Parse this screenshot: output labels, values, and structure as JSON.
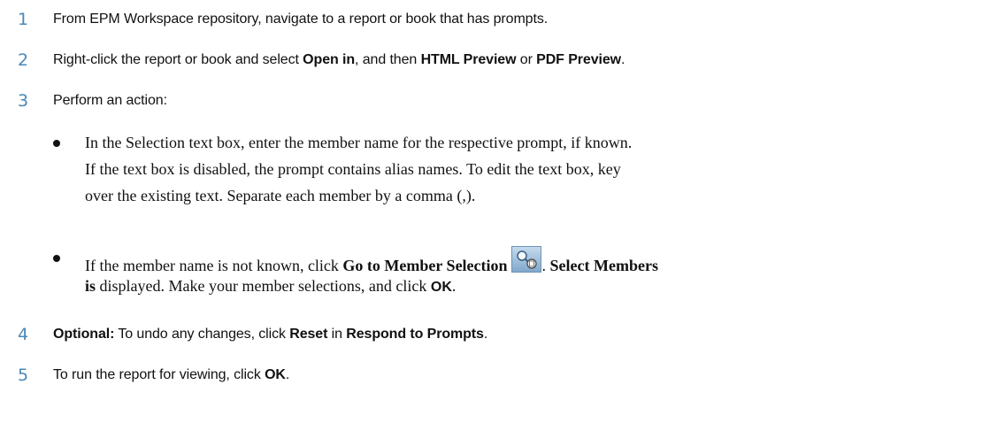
{
  "steps": [
    {
      "number": "1",
      "text": "From EPM Workspace repository, navigate to a report or book that has prompts."
    },
    {
      "number": "2",
      "text_a": "Right-click the report or book and select ",
      "bold_a": "Open in",
      "text_b": ", and then ",
      "bold_b": "HTML Preview",
      "text_c": " or ",
      "bold_c": "PDF Preview",
      "text_d": "."
    },
    {
      "number": "3",
      "text": "Perform an action:"
    },
    {
      "number": "4",
      "bold_a": "Optional:",
      "text_a": " To undo any changes, click ",
      "bold_b": "Reset",
      "text_b": " in ",
      "bold_c": "Respond to Prompts",
      "text_c": "."
    },
    {
      "number": "5",
      "text_a": "To run the report for viewing, click ",
      "bold_a": "OK",
      "text_b": "."
    }
  ],
  "bullets": [
    {
      "line1": "In the Selection text box, enter the member name for the respective prompt, if known.",
      "line2": "If the text box is disabled, the prompt contains alias names. To edit the text box, key",
      "line3": "over the existing text. Separate each member by a comma (,)."
    },
    {
      "line1_a": "If the member name is not known, click ",
      "line1_bold": "Go to Member Selection",
      "line1_b": ". ",
      "line1_bold2": "Select Members",
      "line2_bold": "is",
      "line2_a": " displayed. Make your member selections, and click ",
      "line2_bold2": "OK",
      "line2_b": "."
    }
  ],
  "icons": {
    "member_selection": "member-selection-icon"
  },
  "colors": {
    "step_number": "#4a88b7",
    "icon_bg": "#9fc0dc"
  }
}
